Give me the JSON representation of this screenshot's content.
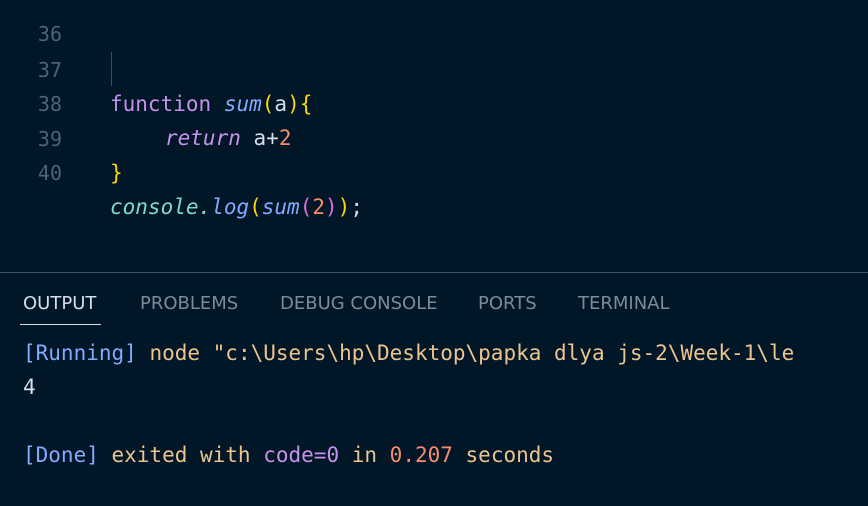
{
  "editor": {
    "top_partial_line_number": "36",
    "lines": [
      {
        "number": "37"
      },
      {
        "number": "38"
      },
      {
        "number": "39"
      },
      {
        "number": "40"
      }
    ],
    "code": {
      "l37": {
        "kw": "function",
        "fn": "sum",
        "open_paren": "(",
        "param": "a",
        "close_paren": ")",
        "open_brace": "{"
      },
      "l38": {
        "ret": "return",
        "expr_a": "a",
        "plus": "+",
        "two": "2"
      },
      "l39": {
        "close_brace": "}"
      },
      "l40": {
        "obj": "console",
        "dot": ".",
        "method": "log",
        "p1": "(",
        "fn": "sum",
        "p2": "(",
        "arg": "2",
        "p3": ")",
        "p4": ")",
        "semi": ";"
      }
    }
  },
  "panel": {
    "tabs": [
      {
        "label": "OUTPUT"
      },
      {
        "label": "PROBLEMS"
      },
      {
        "label": "DEBUG CONSOLE"
      },
      {
        "label": "PORTS"
      },
      {
        "label": "TERMINAL"
      }
    ],
    "active_tab": "OUTPUT",
    "output": {
      "running_tag": "[Running]",
      "running_cmd": " node \"c:\\Users\\hp\\Desktop\\papka dlya js-2\\Week-1\\le",
      "result": "4",
      "done_tag": "[Done]",
      "done_text1": " exited with ",
      "done_code": "code=0",
      "done_text2": " in ",
      "done_time": "0.207",
      "done_text3": " seconds"
    }
  },
  "colors": {
    "background": "#011627",
    "keyword": "#c792ea",
    "function": "#82aaff",
    "number": "#f78c6c",
    "bracket": "#ffd700",
    "object": "#7fdbca"
  }
}
